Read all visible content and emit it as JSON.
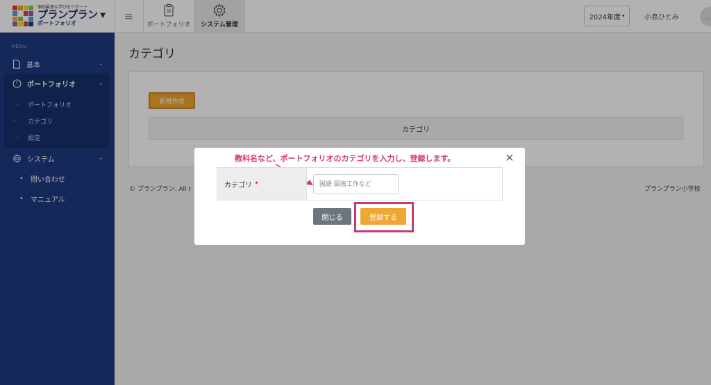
{
  "header": {
    "tagline": "個別最適な学びをサポート",
    "brand_name": "プランプラン",
    "brand_sub": "ポートフォリオ",
    "tabs": [
      {
        "label": "ポートフォリオ",
        "icon": "clipboard-icon"
      },
      {
        "label": "システム管理",
        "icon": "gear-icon"
      }
    ],
    "year": "2024年度",
    "user_name": "小島ひとみ"
  },
  "sidebar": {
    "menu_label": "MENU",
    "items": [
      {
        "label": "基本",
        "icon": "document-icon"
      },
      {
        "label": "ポートフォリオ",
        "icon": "clock-icon"
      },
      {
        "label": "システム",
        "icon": "gear-icon"
      }
    ],
    "portfolio_sub": [
      {
        "label": "ポートフォリオ",
        "bullet": "-"
      },
      {
        "label": "カテゴリ",
        "bullet": "—"
      },
      {
        "label": "設定",
        "bullet": "-"
      }
    ],
    "system_sub": [
      {
        "label": "問い合わせ"
      },
      {
        "label": "マニュアル"
      }
    ]
  },
  "main": {
    "page_title": "カテゴリ",
    "new_button": "新規作成",
    "table_header": "カテゴリ",
    "footer_left": "© プランプラン. All r",
    "footer_right": "プランプラン小学校"
  },
  "modal": {
    "annotation": "教科名など、ポートフォリオのカテゴリを入力し、登録します。",
    "field_label": "カテゴリ",
    "required": "*",
    "placeholder": "国語 図画工作など",
    "close_label": "閉じる",
    "register_label": "登録する"
  },
  "colors": {
    "sidebar_bg": "#1e3a82",
    "accent_orange": "#f0a632",
    "annotation_pink": "#d8356f"
  }
}
